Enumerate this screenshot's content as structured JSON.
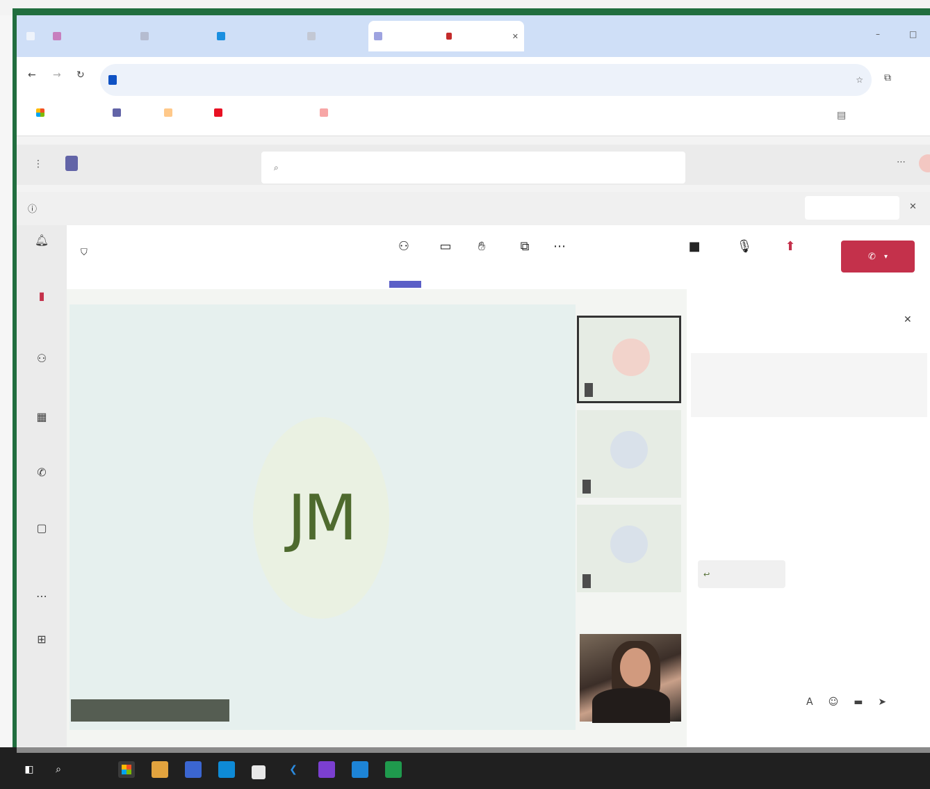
{
  "browser": {
    "tabs": [
      {
        "label": "",
        "color": "#e2a33e"
      },
      {
        "label": "",
        "color": "#6264a7"
      },
      {
        "label": "",
        "color": "#2b7cd3"
      },
      {
        "label": "",
        "color": "#777777"
      },
      {
        "label": "",
        "color": "#6264a7",
        "active": true
      }
    ],
    "address": {
      "url": ""
    },
    "bookmarks": [
      {
        "label": "",
        "color": "#f25022"
      },
      {
        "label": "",
        "color": "#6264a7"
      },
      {
        "label": "",
        "color": "#ffb900"
      },
      {
        "label": "",
        "color": "#e81123"
      },
      {
        "label": "",
        "color": "#f7a6a6"
      }
    ]
  },
  "teams": {
    "search_placeholder": "",
    "banner": {
      "text": "",
      "action": ""
    },
    "rail": [
      {
        "label": "",
        "icon": "activity-icon"
      },
      {
        "label": "",
        "icon": "chat-icon"
      },
      {
        "label": "",
        "icon": "teams-icon"
      },
      {
        "label": "",
        "icon": "calendar-icon"
      },
      {
        "label": "",
        "icon": "calls-icon"
      },
      {
        "label": "",
        "icon": "files-icon"
      },
      {
        "label": "",
        "icon": "more-icon"
      },
      {
        "label": "",
        "icon": "apps-icon"
      }
    ],
    "meeting": {
      "timer": "",
      "tools": [
        {
          "label": "",
          "icon": "people-icon"
        },
        {
          "label": "",
          "icon": "chat-icon"
        },
        {
          "label": "",
          "icon": "raise-hand-icon"
        },
        {
          "label": "",
          "icon": "rooms-icon"
        },
        {
          "label": "",
          "icon": "more-icon"
        },
        {
          "label": "",
          "icon": "camera-icon"
        },
        {
          "label": "",
          "icon": "mic-icon"
        },
        {
          "label": "",
          "icon": "share-icon"
        }
      ],
      "leave_label": "",
      "main_participant": {
        "initials": "JM",
        "name": ""
      },
      "thumbnails": [
        {
          "initials": "",
          "name": "",
          "avatar_bg": "#f2d3cb",
          "color": "#8a2a1f"
        },
        {
          "initials": "",
          "name": "",
          "avatar_bg": "#d9e1ea",
          "color": "#3c5b77"
        },
        {
          "initials": "",
          "name": "",
          "avatar_bg": "#d9e1ea",
          "color": "#3c5b77"
        }
      ],
      "more_label": "",
      "accent": "#5b5fc7",
      "leave_color": "#c4314b"
    },
    "chat": {
      "title": "",
      "notice": "",
      "notice_link": "",
      "messages": [
        {
          "text": ""
        },
        {
          "text": ""
        }
      ],
      "show_more": "",
      "reply": "",
      "compose_link": ""
    }
  },
  "taskbar": {
    "apps": [
      "start-icon",
      "search-icon",
      "edge-icon",
      "file-explorer-icon",
      "office-icon",
      "store-icon",
      "notepad-icon",
      "vscode-icon",
      "onenote-icon",
      "powershell-icon",
      "excel-icon"
    ],
    "tray": {
      "time": "",
      "date": ""
    }
  }
}
